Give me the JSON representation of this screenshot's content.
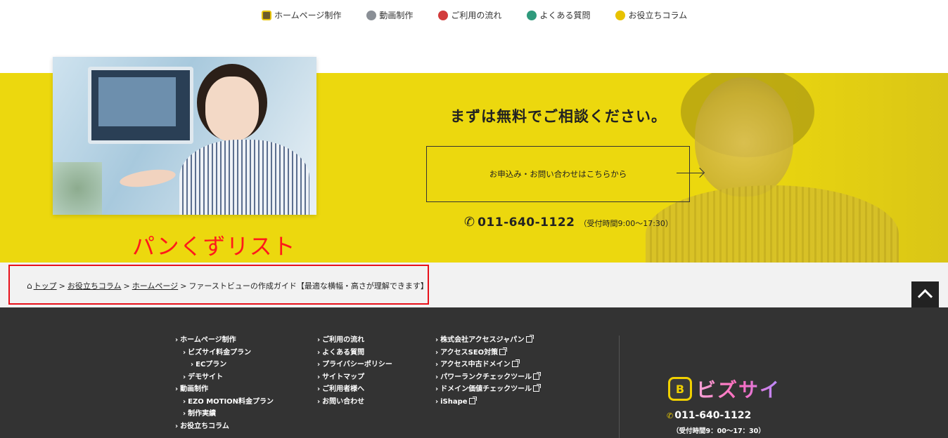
{
  "nav": {
    "items": [
      {
        "label": "ホームページ制作",
        "icon": "homepage-icon"
      },
      {
        "label": "動画制作",
        "icon": "video-icon"
      },
      {
        "label": "ご利用の流れ",
        "icon": "flow-icon"
      },
      {
        "label": "よくある質問",
        "icon": "faq-icon"
      },
      {
        "label": "お役立ちコラム",
        "icon": "column-icon"
      }
    ]
  },
  "hero": {
    "heading": "まずは無料でご相談ください。",
    "cta_label": "お申込み・お問い合わせはこちらから",
    "phone": "011-640-1122",
    "hours": "（受付時間9:00～17:30）",
    "accent_color": "#ecd80e"
  },
  "annotation": {
    "text": "パンくずリスト",
    "color": "#ff1a1a"
  },
  "breadcrumb": {
    "home": "トップ",
    "column": "お役立ちコラム",
    "category": "ホームページ",
    "current": "ファーストビューの作成ガイド【最適な横幅・高さが理解できます】",
    "separator": ">"
  },
  "footer": {
    "col1": [
      {
        "label": "ホームページ制作",
        "level": 0
      },
      {
        "label": "ビズサイ料金プラン",
        "level": 1
      },
      {
        "label": "ECプラン",
        "level": 2
      },
      {
        "label": "デモサイト",
        "level": 1
      },
      {
        "label": "動画制作",
        "level": 0
      },
      {
        "label": "EZO MOTION料金プラン",
        "level": 1
      },
      {
        "label": "制作実績",
        "level": 1
      },
      {
        "label": "お役立ちコラム",
        "level": 0
      }
    ],
    "col2": [
      "ご利用の流れ",
      "よくある質問",
      "プライバシーポリシー",
      "サイトマップ",
      "ご利用者様へ",
      "お問い合わせ"
    ],
    "col3": [
      "株式会社アクセスジャパン",
      "アクセスSEO対策",
      "アクセス中古ドメイン",
      "パワーランクチェックツール",
      "ドメイン価値チェックツール",
      "iShape"
    ],
    "logo_badge": "B",
    "logo_text": "ビズサイ",
    "phone": "011-640-1122",
    "hours": "（受付時間9：00～17：30）"
  }
}
